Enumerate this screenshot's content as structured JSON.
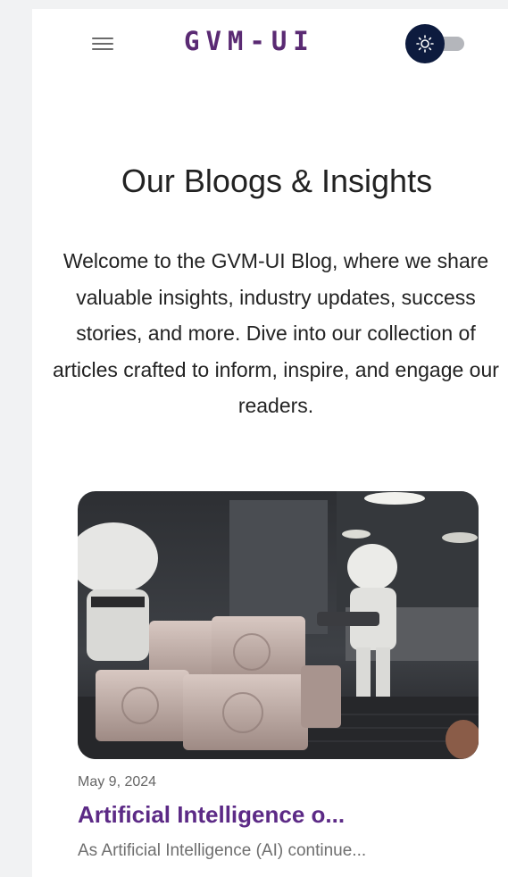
{
  "header": {
    "logo": "GVM-UI",
    "menu_icon": "hamburger-menu-icon",
    "theme_toggle_icon": "sun-icon",
    "theme_toggle_knob_color": "#0d1b3e"
  },
  "intro": {
    "title": "Our Bloogs & Insights",
    "description": "Welcome to the GVM-UI Blog, where we share valuable insights, industry updates, success stories, and more. Dive into our collection of articles crafted to inform, inspire, and engage our readers."
  },
  "posts": [
    {
      "date": "May 9, 2024",
      "title": "Artificial Intelligence o...",
      "excerpt": "As Artificial Intelligence (AI) continue..."
    }
  ],
  "colors": {
    "brand": "#5a2a73",
    "post_title": "#5c2a86",
    "background": "#f1f2f3"
  }
}
